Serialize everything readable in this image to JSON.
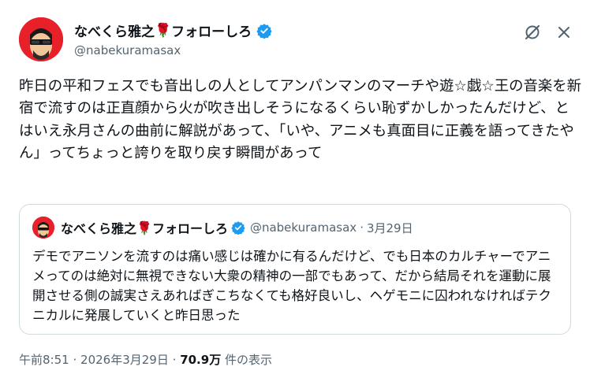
{
  "author": {
    "display_name": "なべくら雅之",
    "rose_emoji": "🌹",
    "display_name_suffix": "フォローしろ",
    "handle": "@nabekuramasax",
    "verified_color": "#1d9bf0"
  },
  "tweet": {
    "text": "昨日の平和フェスでも音出しの人としてアンパンマンのマーチや遊☆戯☆王の音楽を新宿で流すのは正直顔から火が吹き出しそうになるくらい恥ずかしかったんだけど、とはいえ永月さんの曲前に解説があって、「いや、アニメも真面目に正義を語ってきたやん」ってちょっと誇りを取り戻す瞬間があって"
  },
  "quoted": {
    "display_name": "なべくら雅之",
    "rose_emoji": "🌹",
    "display_name_suffix": "フォローしろ",
    "handle": "@nabekuramasax",
    "separator": "·",
    "date": "3月29日",
    "text": "デモでアニソンを流すのは痛い感じは確かに有るんだけど、でも日本のカルチャーでアニメってのは絶対に無視できない大衆の精神の一部でもあって、だから結局それを運動に展開させる側の誠実さえあればぎこちなくても格好良いし、ヘゲモニに囚われなければテクニカルに発展していくと昨日思った"
  },
  "meta": {
    "time": "午前8:51",
    "sep1": "·",
    "date": "2026年3月29日",
    "sep2": "·",
    "views": "70.9万",
    "views_label": "件の表示"
  },
  "icons": {
    "grok": "grok-icon",
    "more": "close-icon"
  }
}
